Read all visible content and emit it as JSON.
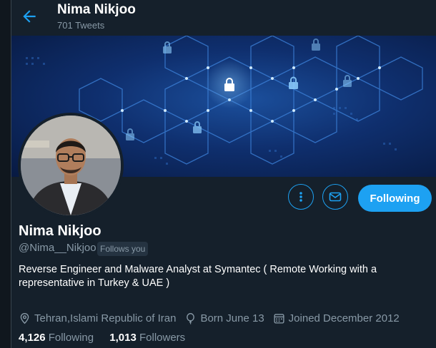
{
  "header": {
    "back_icon": "arrow-left-icon",
    "title": "Nima Nikjoo",
    "tweet_count": "701 Tweets"
  },
  "profile": {
    "display_name": "Nima Nikjoo",
    "handle": "@Nima__Nikjoo",
    "follows_you": "Follows you",
    "bio": "Reverse Engineer and Malware Analyst at Symantec ( Remote Working with a representative in Turkey & UAE )",
    "location": "Tehran,Islami Republic of Iran",
    "birthday": "Born June 13",
    "joined": "Joined December 2012",
    "following_count": "4,126",
    "following_label": "Following",
    "followers_count": "1,013",
    "followers_label": "Followers"
  },
  "actions": {
    "more_icon": "more-vertical-icon",
    "message_icon": "envelope-icon",
    "follow_button": "Following"
  },
  "colors": {
    "background": "#15202b",
    "accent": "#1da1f2",
    "secondary_text": "#8899a6"
  }
}
